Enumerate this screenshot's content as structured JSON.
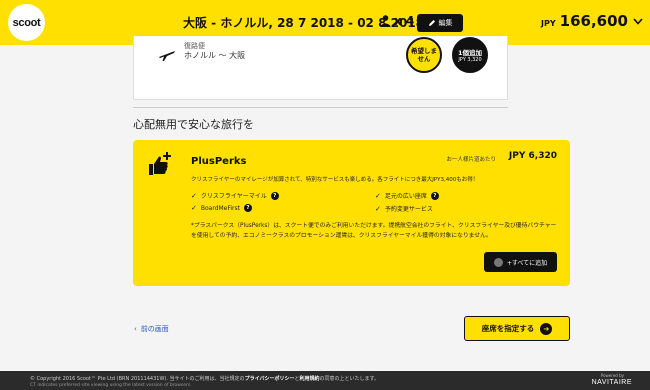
{
  "header": {
    "logo_text": "scoot",
    "route_dates": "大阪 - ホノルル, 28 7 2018 - 02 8 2018",
    "pax_count": "x 4",
    "edit_label": "編集",
    "currency": "JPY",
    "total": "166,600",
    "brand_color": "#ffe000"
  },
  "flight_card": {
    "type_label": "復路便",
    "route": "ホノルル 〜 大阪",
    "option_none": [
      "希望しま",
      "せん"
    ],
    "option_one_label": "1個追加",
    "option_one_price": "JPY 3,320"
  },
  "section": {
    "title": "心配無用で安心な旅行を"
  },
  "perks": {
    "title": "PlusPerks",
    "price_label": "お一人様片道あたり",
    "price": "JPY 6,320",
    "description": "クリスフライヤーのマイレージが加算されて、特別なサービスも楽しめる。各フライトにつき最大JPY3,400もお得！",
    "features": [
      "クリスフライヤーマイル",
      "足元の広い座席",
      "BoardMeFirst",
      "予約変更サービス"
    ],
    "note": "*プラスパークス（PlusPerks）は、スクート便でのみご利用いただけます。提携航空会社のフライト、クリスフライヤー及び優待バウチャーを使用しての予約、エコノミークラスのプロモーション運賃は、クリスフライヤーマイル獲得の対象になりません。",
    "add_all_label": "+すべてに追加"
  },
  "nav": {
    "back_label": "前の画面",
    "next_label": "座席を指定する"
  },
  "footer": {
    "copyright_pre": "© Copyright 2016 Scoot™ Pte Ltd (BRN 201114431W). 当サイトのご利用は、当社規定の",
    "privacy": "プライバシーポリシー",
    "and": "と",
    "terms": "利用規約",
    "copyright_post": "の同意の上といたします。",
    "sub": "CT indicates preferred site viewing using the latest version of browsers.",
    "powered_by": "Powered by",
    "navitaire": "NAVITAIRE"
  }
}
